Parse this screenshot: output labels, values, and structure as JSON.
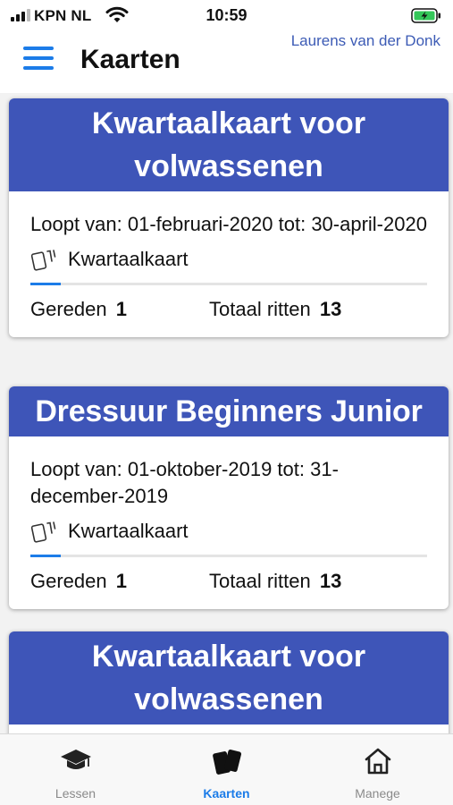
{
  "status": {
    "carrier": "KPN NL",
    "time": "10:59"
  },
  "header": {
    "title": "Kaarten",
    "user": "Laurens van der Donk"
  },
  "cards": [
    {
      "title": "Kwartaalkaart voor volwassenen",
      "period": "Loopt van: 01-februari-2020 tot: 30-april-2020",
      "type": "Kwartaalkaart",
      "ridden_label": "Gereden",
      "ridden": "1",
      "total_label": "Totaal ritten",
      "total": "13",
      "progress_fraction": 0.077
    },
    {
      "title": "Dressuur Beginners Junior",
      "period": "Loopt van: 01-oktober-2019 tot: 31-december-2019",
      "type": "Kwartaalkaart",
      "ridden_label": "Gereden",
      "ridden": "1",
      "total_label": "Totaal ritten",
      "total": "13",
      "progress_fraction": 0.077
    },
    {
      "title": "Kwartaalkaart voor volwassenen"
    }
  ],
  "tabs": [
    {
      "label": "Lessen",
      "icon": "graduation-cap-icon",
      "active": false
    },
    {
      "label": "Kaarten",
      "icon": "cards-icon",
      "active": true
    },
    {
      "label": "Manege",
      "icon": "home-icon",
      "active": false
    }
  ],
  "colors": {
    "accent": "#1c7ce8",
    "card_header": "#3e55b8",
    "username": "#3c5bb5",
    "battery": "#34c759"
  }
}
